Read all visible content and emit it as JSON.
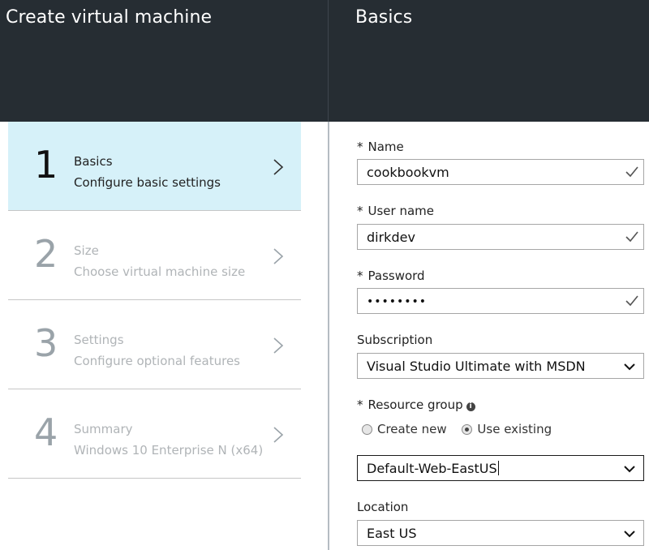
{
  "left_blade": {
    "title": "Create virtual machine",
    "steps": [
      {
        "number": "1",
        "name": "Basics",
        "description": "Configure basic settings",
        "active": true
      },
      {
        "number": "2",
        "name": "Size",
        "description": "Choose virtual machine size",
        "active": false
      },
      {
        "number": "3",
        "name": "Settings",
        "description": "Configure optional features",
        "active": false
      },
      {
        "number": "4",
        "name": "Summary",
        "description": "Windows 10 Enterprise N (x64)",
        "active": false
      }
    ]
  },
  "right_blade": {
    "title": "Basics",
    "name_field": {
      "required": "*",
      "label": "Name",
      "value": "cookbookvm",
      "icon": "check-icon"
    },
    "username_field": {
      "required": "*",
      "label": "User name",
      "value": "dirkdev",
      "icon": "check-icon"
    },
    "password_field": {
      "required": "*",
      "label": "Password",
      "value": "••••••••",
      "icon": "check-icon"
    },
    "subscription": {
      "label": "Subscription",
      "value": "Visual Studio Ultimate with MSDN",
      "icon": "chevron-down-icon"
    },
    "resource_group": {
      "required": "*",
      "label": "Resource group",
      "info_icon": "info-icon",
      "info_glyph": "i",
      "option_create": "Create new",
      "option_existing": "Use existing",
      "selected_option": "Use existing",
      "value": "Default-Web-EastUS"
    },
    "location": {
      "label": "Location",
      "value": "East US"
    }
  },
  "colors": {
    "topbar": "#262d33",
    "active_step": "#d6f1f9",
    "check": "#555555"
  }
}
